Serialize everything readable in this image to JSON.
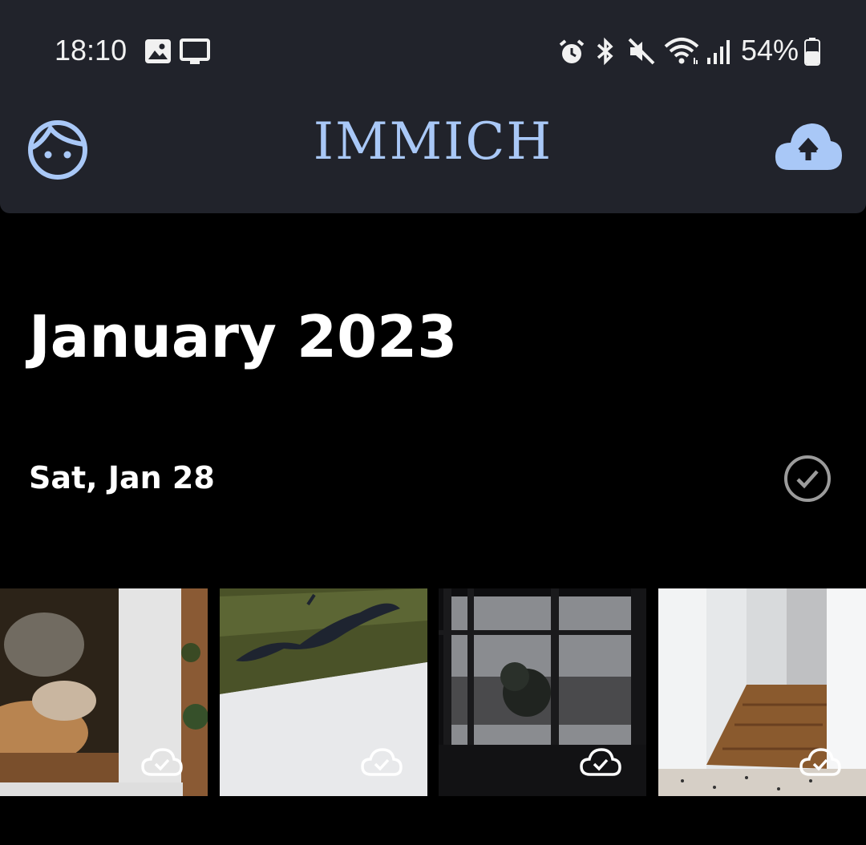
{
  "status_bar": {
    "time": "18:10",
    "battery": "54%",
    "icons": [
      "gallery-icon",
      "screen-cast-icon",
      "alarm-icon",
      "bluetooth-icon",
      "mute-icon",
      "wifi-icon",
      "signal-icon",
      "battery-icon"
    ]
  },
  "app_bar": {
    "title": "IMMICH",
    "profile_icon": "face-icon",
    "upload_icon": "cloud-upload-icon"
  },
  "timeline": {
    "month_title": "January 2023",
    "groups": [
      {
        "date_label": "Sat, Jan 28",
        "select_icon": "check-circle-icon",
        "assets": [
          {
            "subject": "fox photo print",
            "badge": "cloud-done-icon"
          },
          {
            "subject": "heron photo print",
            "badge": "cloud-done-icon"
          },
          {
            "subject": "window view",
            "badge": "cloud-done-icon"
          },
          {
            "subject": "hallway door",
            "badge": "cloud-done-icon"
          }
        ]
      }
    ]
  },
  "colors": {
    "app_bar_bg": "#21232b",
    "accent": "#a9c8f7",
    "background": "#000000"
  }
}
